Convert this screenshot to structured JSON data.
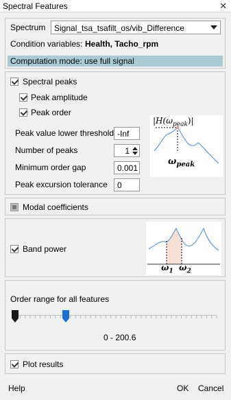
{
  "window": {
    "title": "Spectral Features",
    "close_glyph": "✕"
  },
  "spectrum": {
    "label": "Spectrum",
    "selected": "Signal_tsa_tsafilt_os/vib_Difference",
    "condition_prefix": "Condition variables:",
    "condition_values": "Health, Tacho_rpm",
    "computation_mode": "Computation mode: use full signal"
  },
  "spectral_peaks": {
    "label": "Spectral peaks",
    "checked": true,
    "peak_amplitude": {
      "label": "Peak amplitude",
      "checked": true
    },
    "peak_order": {
      "label": "Peak order",
      "checked": true
    },
    "fields": {
      "threshold_label": "Peak value lower threshold",
      "threshold_value": "-Inf",
      "num_peaks_label": "Number of peaks",
      "num_peaks_value": "1",
      "min_gap_label": "Minimum order gap",
      "min_gap_value": "0.001",
      "excursion_label": "Peak excursion tolerance",
      "excursion_value": "0"
    },
    "figure": {
      "h_label": "|H(ω",
      "h_sub": "peak",
      "h_end": ")|",
      "w_label": "ω",
      "w_sub": "peak"
    }
  },
  "modal": {
    "label": "Modal coefficients",
    "checked": false
  },
  "band_power": {
    "label": "Band power",
    "checked": true,
    "figure": {
      "w1": "ω",
      "w1_sub": "1",
      "w2": "ω",
      "w2_sub": "2"
    }
  },
  "order_range": {
    "label": "Order range for all features",
    "range_text": "0 - 200.6",
    "low_fraction": 0.0,
    "high_fraction": 0.25
  },
  "plot_results": {
    "label": "Plot results",
    "checked": true
  },
  "footer": {
    "help": "Help",
    "ok": "OK",
    "cancel": "Cancel"
  },
  "colors": {
    "banner": "#aacbd4",
    "slider_high": "#1f6fd0",
    "band_fill": "#f6e0d6",
    "curve": "#6a9bd0"
  }
}
